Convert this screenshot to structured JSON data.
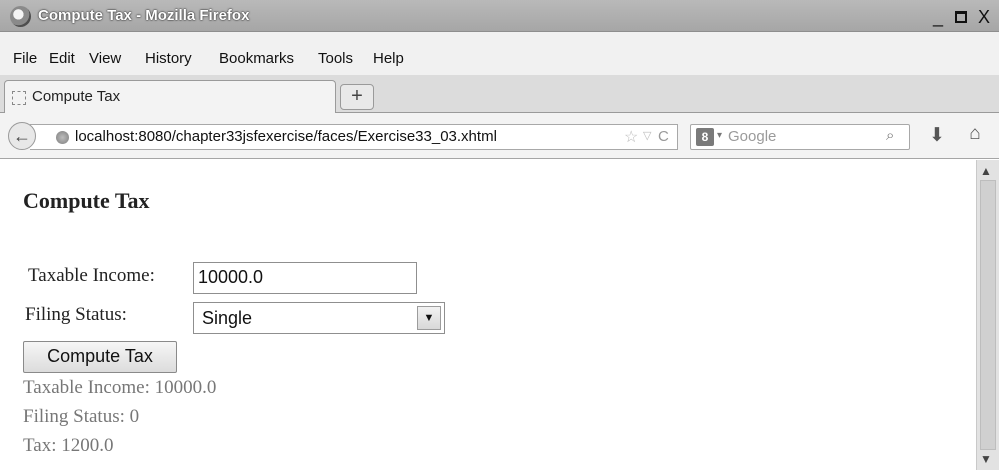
{
  "window": {
    "title": "Compute Tax - Mozilla Firefox",
    "minimize_glyph": "_",
    "close_glyph": "X"
  },
  "menu": [
    "File",
    "Edit",
    "View",
    "History",
    "Bookmarks",
    "Tools",
    "Help"
  ],
  "tab": {
    "label": "Compute Tax",
    "new_tab_glyph": "+"
  },
  "nav": {
    "back_glyph": "←",
    "url": "localhost:8080/chapter33jsfexercise/faces/Exercise33_03.xhtml",
    "star_glyph": "☆",
    "dropdown_glyph": "▽",
    "reload_glyph": "C",
    "search_engine_glyph": "8",
    "search_drop_glyph": "▾",
    "search_placeholder": "Google",
    "search_icon_glyph": "⌕",
    "download_glyph": "⬇",
    "home_glyph": "⌂"
  },
  "page": {
    "heading": "Compute Tax",
    "income_label": "Taxable Income:",
    "income_value": "10000.0",
    "status_label": "Filing Status:",
    "status_value": "Single",
    "select_arrow_glyph": "▼",
    "button_label": "Compute Tax",
    "results": [
      "Taxable Income: 10000.0",
      "Filing Status: 0",
      "Tax: 1200.0"
    ]
  },
  "scrollbar": {
    "up_glyph": "▲",
    "down_glyph": "▼"
  }
}
